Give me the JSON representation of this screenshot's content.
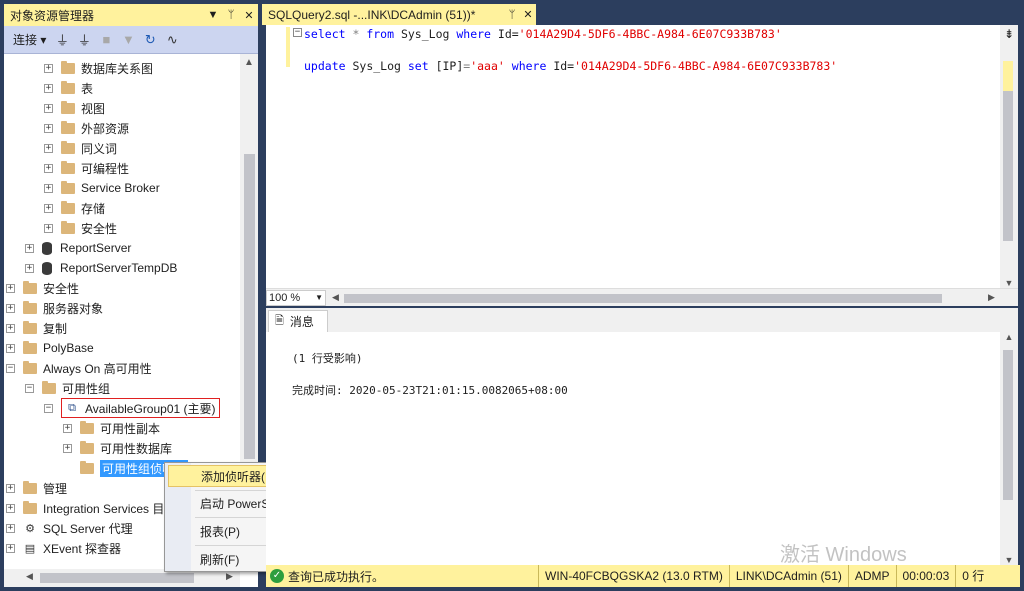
{
  "object_explorer": {
    "title": "对象资源管理器",
    "title_buttons": [
      "▼",
      "ᛘ",
      "✕"
    ],
    "toolbar": {
      "connect_label": "连接"
    },
    "tree": [
      {
        "label": "数据库关系图",
        "level": 2,
        "kind": "folder",
        "expander": "+"
      },
      {
        "label": "表",
        "level": 2,
        "kind": "folder",
        "expander": "+"
      },
      {
        "label": "视图",
        "level": 2,
        "kind": "folder",
        "expander": "+"
      },
      {
        "label": "外部资源",
        "level": 2,
        "kind": "folder",
        "expander": "+"
      },
      {
        "label": "同义词",
        "level": 2,
        "kind": "folder",
        "expander": "+"
      },
      {
        "label": "可编程性",
        "level": 2,
        "kind": "folder",
        "expander": "+"
      },
      {
        "label": "Service Broker",
        "level": 2,
        "kind": "folder",
        "expander": "+"
      },
      {
        "label": "存储",
        "level": 2,
        "kind": "folder",
        "expander": "+"
      },
      {
        "label": "安全性",
        "level": 2,
        "kind": "folder",
        "expander": "+"
      },
      {
        "label": "ReportServer",
        "level": 1,
        "kind": "db",
        "expander": "+"
      },
      {
        "label": "ReportServerTempDB",
        "level": 1,
        "kind": "db",
        "expander": "+"
      },
      {
        "label": "安全性",
        "level": 0,
        "kind": "folder",
        "expander": "+"
      },
      {
        "label": "服务器对象",
        "level": 0,
        "kind": "folder",
        "expander": "+"
      },
      {
        "label": "复制",
        "level": 0,
        "kind": "folder",
        "expander": "+"
      },
      {
        "label": "PolyBase",
        "level": 0,
        "kind": "folder",
        "expander": "+"
      },
      {
        "label": "Always On 高可用性",
        "level": 0,
        "kind": "folder",
        "expander": "−"
      },
      {
        "label": "可用性组",
        "level": 1,
        "kind": "folder",
        "expander": "−"
      },
      {
        "label": "AvailableGroup01 (主要)",
        "level": 2,
        "kind": "group",
        "expander": "−",
        "highlighted": true
      },
      {
        "label": "可用性副本",
        "level": 3,
        "kind": "folder",
        "expander": "+"
      },
      {
        "label": "可用性数据库",
        "level": 3,
        "kind": "folder",
        "expander": "+"
      },
      {
        "label": "可用性组侦听器",
        "level": 3,
        "kind": "folder",
        "expander": "",
        "selected": true
      },
      {
        "label": "管理",
        "level": 0,
        "kind": "folder",
        "expander": "+"
      },
      {
        "label": "Integration Services 目录",
        "level": 0,
        "kind": "folder",
        "expander": "+"
      },
      {
        "label": "SQL Server 代理",
        "level": 0,
        "kind": "agent",
        "expander": "+"
      },
      {
        "label": "XEvent 探查器",
        "level": 0,
        "kind": "xevent",
        "expander": "+"
      }
    ]
  },
  "context_menu": {
    "items": [
      {
        "label": "添加侦听器(L)...",
        "hot": true
      },
      {
        "label": "启动 PowerShell(H)"
      },
      {
        "label": "报表(P)",
        "submenu": true
      },
      {
        "label": "刷新(F)"
      }
    ]
  },
  "editor": {
    "tab_title": "SQLQuery2.sql -...INK\\DCAdmin (51))*",
    "tab_buttons": [
      "ᛘ",
      "✕"
    ],
    "line1": {
      "kw1": "select",
      "p1": " * ",
      "kw2": "from",
      "p2": " Sys_Log ",
      "kw3": "where",
      "p3": " Id=",
      "str": "'014A29D4-5DF6-4BBC-A984-6E07C933B783'"
    },
    "line2": {
      "kw1": "update",
      "p1": " Sys_Log ",
      "kw2": "set",
      "p2": " [IP]",
      "eq": "=",
      "str1": "'aaa'",
      "p3": " ",
      "kw3": "where",
      "p4": " Id=",
      "str2": "'014A29D4-5DF6-4BBC-A984-6E07C933B783'"
    },
    "zoom": "100 %"
  },
  "results": {
    "tab_label": "消息",
    "lines": [
      "(1 行受影响)",
      "完成时间: 2020-05-23T21:01:15.0082065+08:00"
    ]
  },
  "status_bar": {
    "message": "查询已成功执行。",
    "server": "WIN-40FCBQGSKA2 (13.0 RTM)",
    "login": "LINK\\DCAdmin (51)",
    "database": "ADMP",
    "elapsed": "00:00:03",
    "rows": "0 行"
  },
  "watermark": "激活 Windows",
  "colors": {
    "accent": "#fff29d",
    "frame": "#2c3e5e",
    "keyword": "#0000ff",
    "string": "#e00000"
  }
}
